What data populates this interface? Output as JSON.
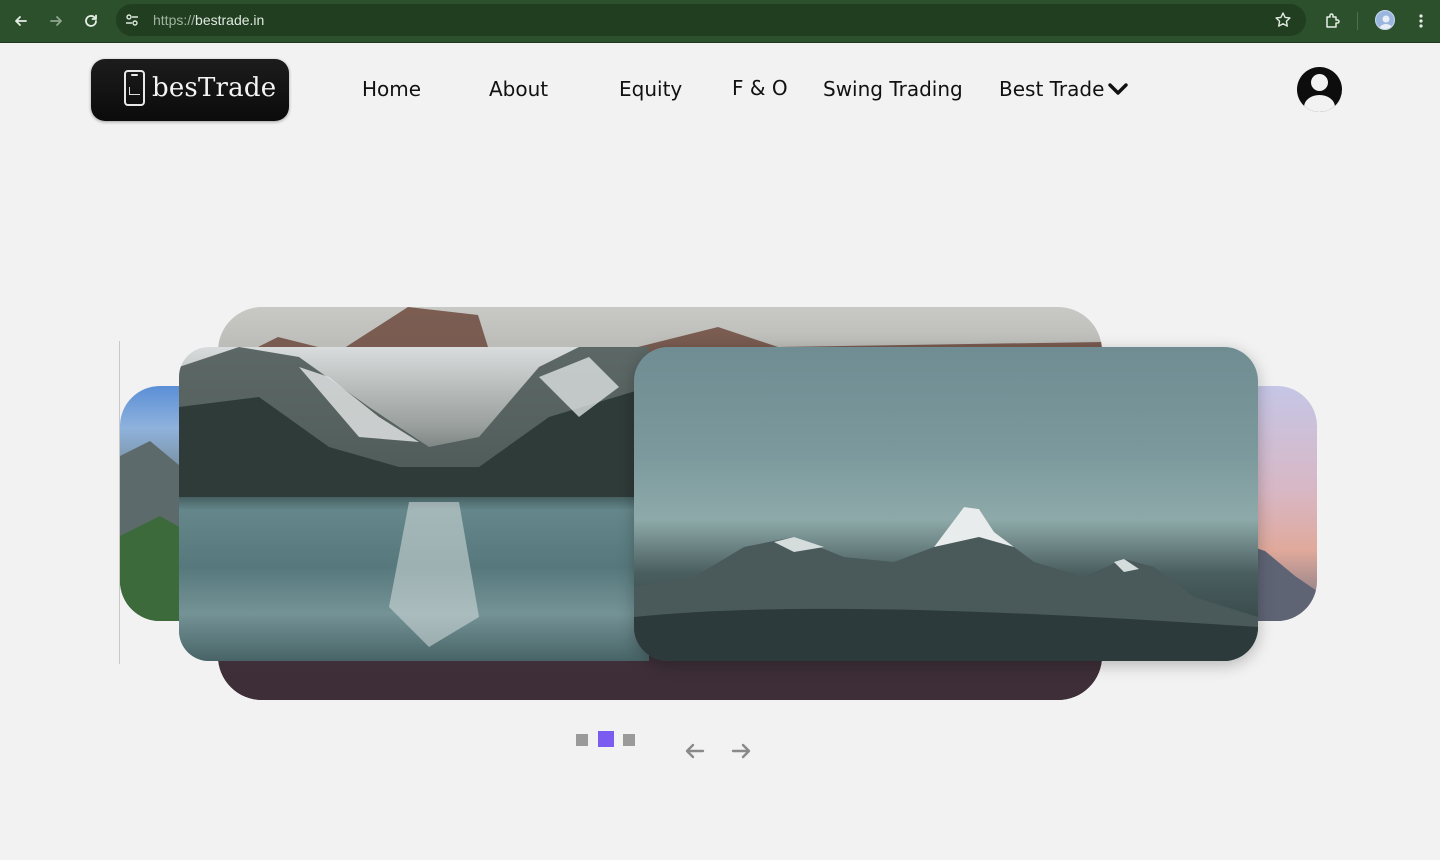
{
  "browser": {
    "url_protocol": "https://",
    "url_host": "bestrade.in",
    "theme_color": "#2c4f2c"
  },
  "header": {
    "logo_text": "besTrade",
    "nav": {
      "home": "Home",
      "about": "About",
      "equity": "Equity",
      "fo": "F & O",
      "swing": "Swing Trading",
      "best_trade": "Best Trade"
    }
  },
  "carousel": {
    "slide_count": 3,
    "active_index": 1,
    "active_dot_color": "#7b5cf0",
    "inactive_dot_color": "#9a9a9a",
    "icons": {
      "prev": "arrow-left-icon",
      "next": "arrow-right-icon"
    }
  }
}
